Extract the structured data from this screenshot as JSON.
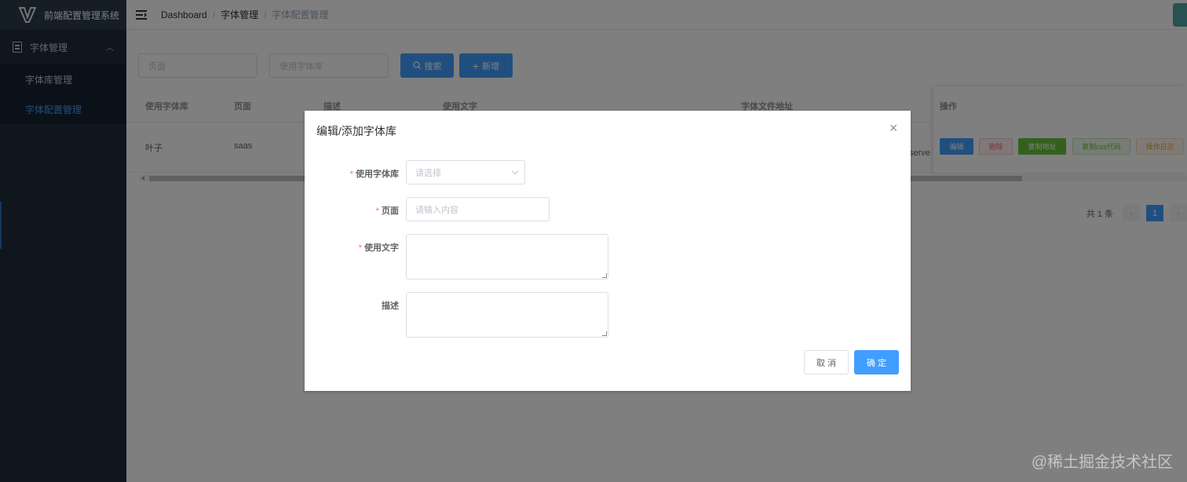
{
  "app": {
    "title": "前端配置管理系统"
  },
  "sidebar": {
    "menu": {
      "label": "字体管理",
      "icon": "document-icon"
    },
    "items": [
      {
        "label": "字体库管理",
        "active": false
      },
      {
        "label": "字体配置管理",
        "active": true
      }
    ]
  },
  "breadcrumb": [
    "Dashboard",
    "字体管理",
    "字体配置管理"
  ],
  "filters": {
    "page_placeholder": "页面",
    "font_lib_placeholder": "使用字体库",
    "search_label": "搜索",
    "add_label": "新增"
  },
  "table": {
    "columns": [
      "使用字体库",
      "页面",
      "描述",
      "使用文字",
      "字体文件地址",
      "操作"
    ],
    "rows": [
      {
        "font_lib": "叶子",
        "page": "saas",
        "desc": "",
        "text": "",
        "url_fragment": "serve"
      }
    ],
    "row_actions": [
      "编辑",
      "删除",
      "复制地址",
      "复制css代码",
      "操作日志"
    ]
  },
  "pagination": {
    "total_text": "共 1 条",
    "current": "1"
  },
  "dialog": {
    "title": "编辑/添加字体库",
    "fields": [
      {
        "label": "使用字体库",
        "required": true,
        "placeholder": "请选择"
      },
      {
        "label": "页面",
        "required": true,
        "placeholder": "请输入内容"
      },
      {
        "label": "使用文字",
        "required": true
      },
      {
        "label": "描述",
        "required": false
      }
    ],
    "cancel_label": "取 消",
    "ok_label": "确 定"
  },
  "watermark": "@稀土掘金技术社区",
  "colors": {
    "primary": "#409eff",
    "danger": "#f56c6c",
    "success": "#67c23a",
    "warning": "#e6a23c",
    "sidebar": "#1f2d3d"
  }
}
